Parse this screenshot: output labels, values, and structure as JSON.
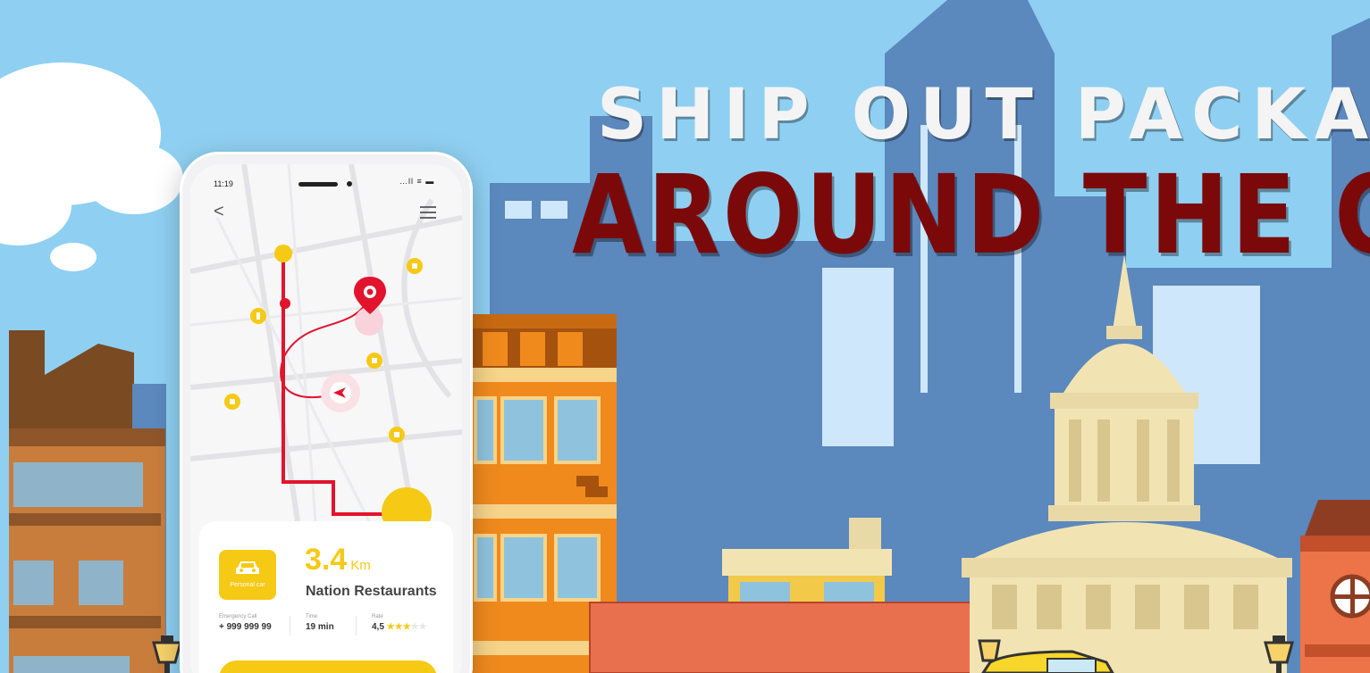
{
  "headline": {
    "line1": "SHIP OUT PACKAGA",
    "line2": "AROUND THE CLO"
  },
  "phone": {
    "status_time": "11:19",
    "status_icons": "…ll ≡ ▬",
    "back_label": "<",
    "card": {
      "badge_label": "Personal car",
      "distance_value": "3.4",
      "distance_unit": "Km",
      "place": "Nation Restaurants",
      "emergency_label": "Emergency Call",
      "emergency_value": "+ 999 999 99",
      "time_label": "Time",
      "time_value": "19 min",
      "rate_label": "Rate",
      "rate_value": "4,5",
      "rate_stars_filled": "★★★",
      "rate_stars_empty": "★★"
    }
  },
  "colors": {
    "sky": "#8fd0f2",
    "skyline": "#5b88bd",
    "accent_yellow": "#f6c915",
    "route_red": "#e2142d",
    "headline_dark_red": "#7b0909"
  },
  "icons": [
    "back-chevron-icon",
    "menu-icon",
    "location-pin-icon",
    "navigation-arrow-icon",
    "car-icon",
    "star-icon"
  ]
}
